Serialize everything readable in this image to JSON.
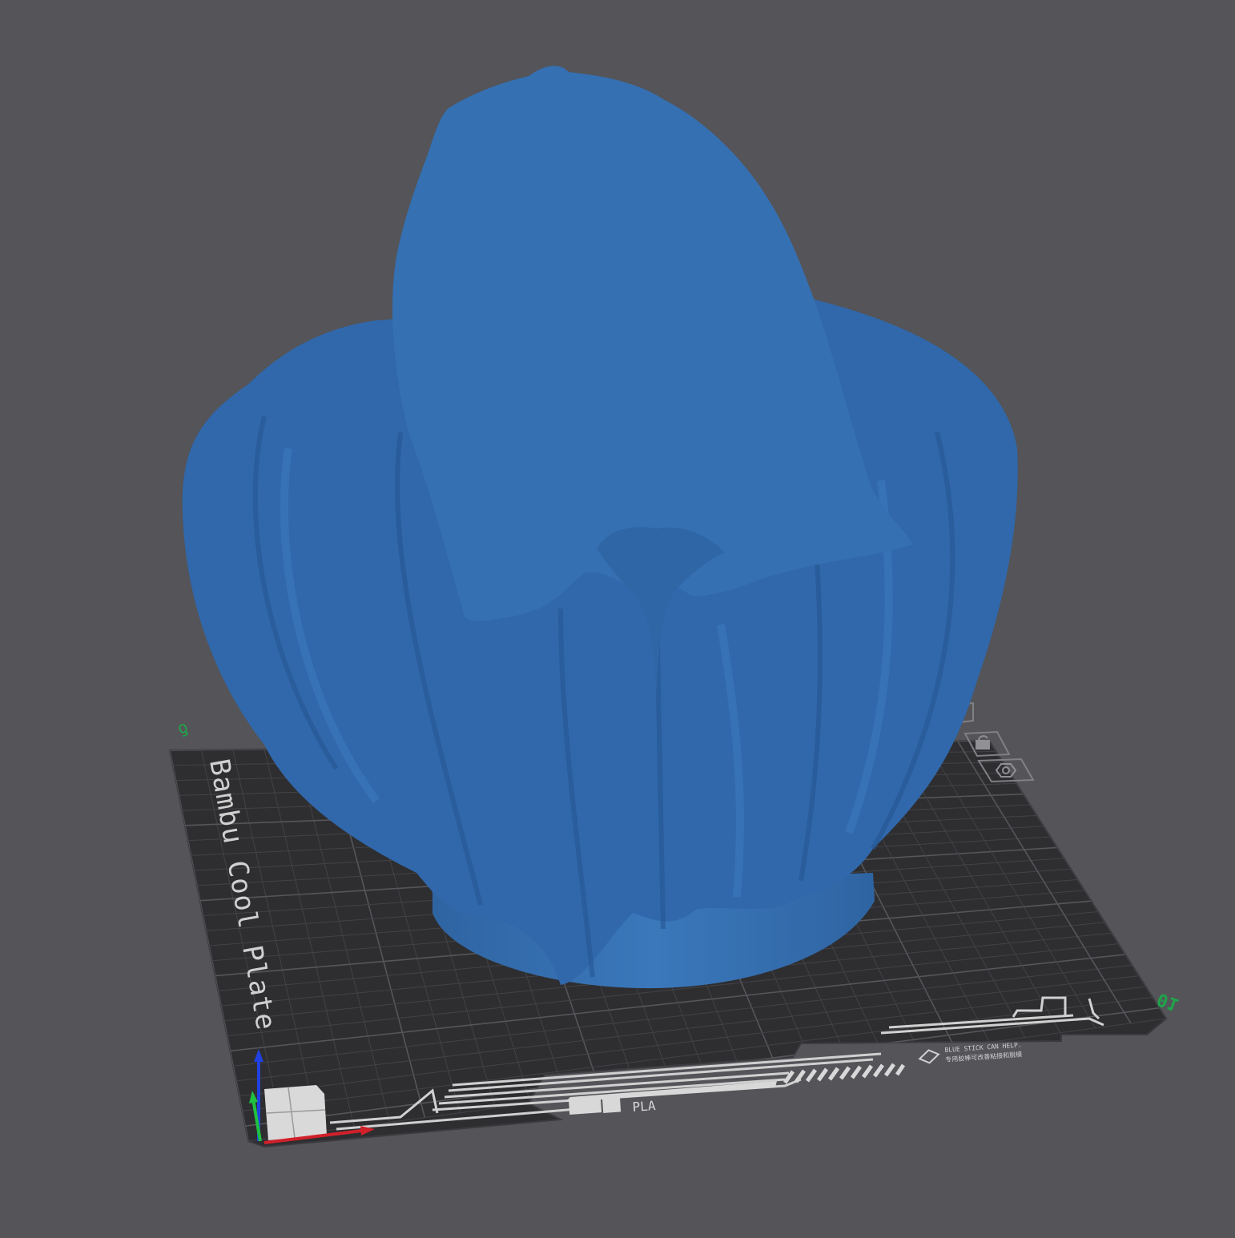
{
  "viewport": {
    "background_color": "#545459",
    "model_color": "#3571b3",
    "plate_color": "#2e2e31",
    "grid_color": "#4a4a4e"
  },
  "plate": {
    "name": "Bambu Cool Plate",
    "plate_number": "01",
    "corner_marker": "ƍ",
    "notice_en": "BLUE STICK CAN HELP.",
    "notice_cn": "专用胶棒可改善粘接和脱模",
    "filament_label": "PLA"
  },
  "plate_icons": [
    "lock-icon",
    "hex-nut-icon"
  ],
  "axes": {
    "x_color": "#d0202a",
    "y_color": "#20c040",
    "z_color": "#2040e0"
  }
}
